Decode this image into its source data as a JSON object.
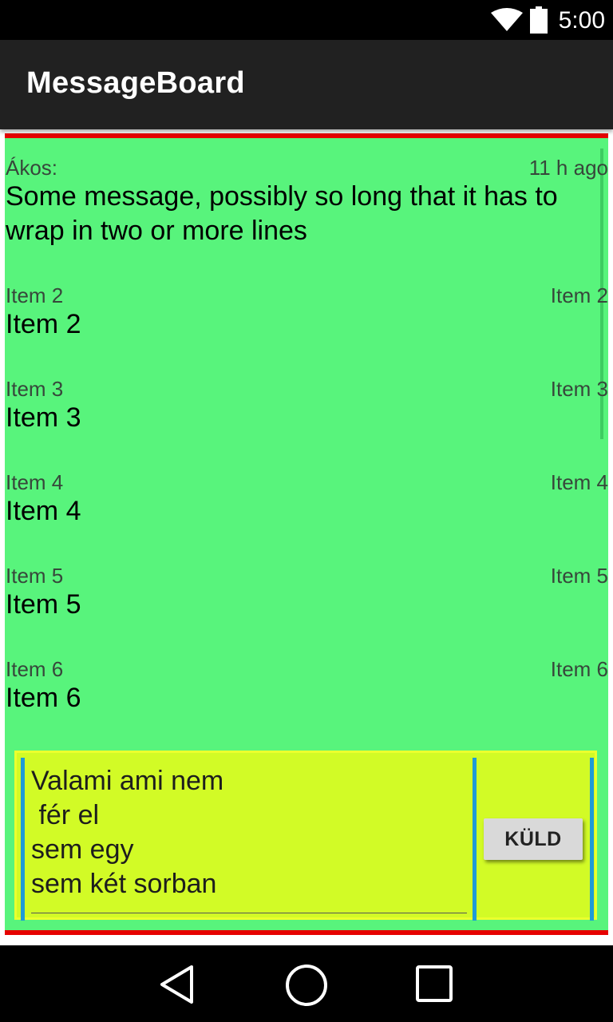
{
  "status_bar": {
    "time": "5:00",
    "icons": [
      "wifi-icon",
      "battery-icon"
    ]
  },
  "app_bar": {
    "title": "MessageBoard"
  },
  "messages": [
    {
      "sender": "Ákos:",
      "time": "11 h ago",
      "text": "Some message, possibly so long that it has to wrap in two or more lines"
    },
    {
      "sender": "Item 2",
      "time": "Item 2",
      "text": "Item 2"
    },
    {
      "sender": "Item 3",
      "time": "Item 3",
      "text": "Item 3"
    },
    {
      "sender": "Item 4",
      "time": "Item 4",
      "text": "Item 4"
    },
    {
      "sender": "Item 5",
      "time": "Item 5",
      "text": "Item 5"
    },
    {
      "sender": "Item 6",
      "time": "Item 6",
      "text": "Item 6"
    }
  ],
  "compose": {
    "input_value": "Valami ami nem\n fér el\nsem egy\nsem két sorban",
    "send_label": "KÜLD"
  },
  "nav_bar": {
    "icons": [
      "back-icon",
      "home-icon",
      "recent-apps-icon"
    ]
  },
  "colors": {
    "list_background": "#58f47c",
    "divider_red": "#e60000",
    "compose_background": "#d2fb26",
    "accent_blue": "#1f9bd6"
  }
}
